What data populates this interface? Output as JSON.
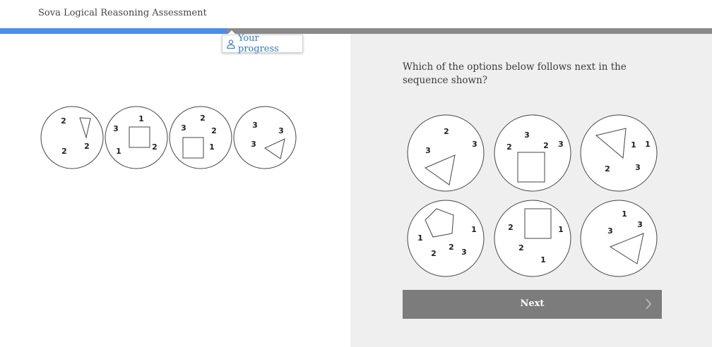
{
  "header": {
    "title": "Sova Logical Reasoning Assessment"
  },
  "progress": {
    "fraction": 0.318,
    "popover_label": "Your progress",
    "icon": "person-icon"
  },
  "question": {
    "text": "Which of the options below follows next in the sequence shown?"
  },
  "sequence": [
    {
      "shape": "triangle",
      "numbers": [
        "2",
        "2",
        "2"
      ]
    },
    {
      "shape": "square",
      "numbers": [
        "1",
        "3",
        "2",
        "1"
      ]
    },
    {
      "shape": "square",
      "numbers": [
        "2",
        "3",
        "2",
        "1"
      ]
    },
    {
      "shape": "triangle",
      "numbers": [
        "3",
        "3",
        "3"
      ]
    }
  ],
  "options": [
    {
      "shape": "triangle",
      "numbers": [
        "2",
        "3",
        "3"
      ]
    },
    {
      "shape": "square",
      "numbers": [
        "3",
        "2",
        "2",
        "3"
      ]
    },
    {
      "shape": "triangle",
      "numbers": [
        "1",
        "1",
        "2",
        "3"
      ]
    },
    {
      "shape": "pentagon",
      "numbers": [
        "1",
        "1",
        "2",
        "2",
        "3"
      ]
    },
    {
      "shape": "square",
      "numbers": [
        "2",
        "1",
        "2",
        "1"
      ]
    },
    {
      "shape": "triangle",
      "numbers": [
        "1",
        "3",
        "3"
      ]
    }
  ],
  "next_button": {
    "label": "Next",
    "icon": "chevron-right-icon"
  },
  "colors": {
    "progress_fill": "#4a8ee6",
    "progress_track": "#8a8a8a",
    "button": "#7c7c7c",
    "panel": "#efefef",
    "link": "#2f7bbf"
  }
}
